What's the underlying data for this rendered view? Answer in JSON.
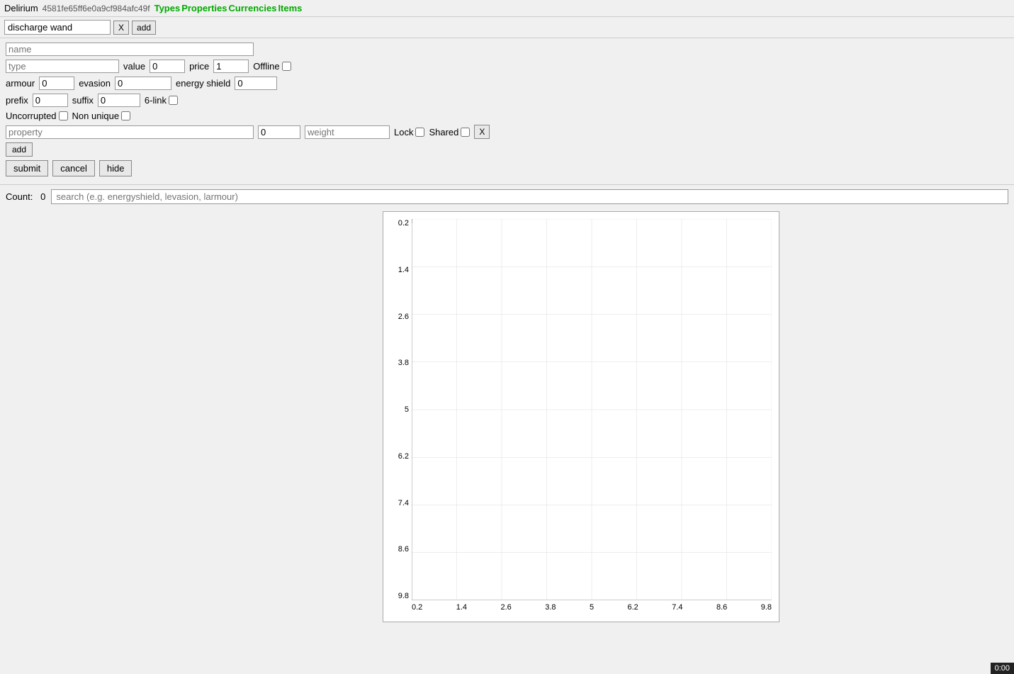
{
  "header": {
    "app_title": "Delirium",
    "app_id": "4581fe65ff6e0a9cf984afc49f",
    "nav": {
      "types_label": "Types",
      "properties_label": "Properties",
      "currencies_label": "Currencies",
      "items_label": "Items"
    }
  },
  "search_bar": {
    "input_value": "discharge wand",
    "x_button_label": "X",
    "add_button_label": "add"
  },
  "form": {
    "name_placeholder": "name",
    "type_placeholder": "type",
    "value_label": "value",
    "value_value": "0",
    "price_label": "price",
    "price_value": "1",
    "offline_label": "Offline",
    "armour_label": "armour",
    "armour_value": "0",
    "evasion_label": "evasion",
    "evasion_value": "0",
    "energy_shield_label": "energy shield",
    "energy_shield_value": "0",
    "prefix_label": "prefix",
    "prefix_value": "0",
    "suffix_label": "suffix",
    "suffix_value": "0",
    "six_link_label": "6-link",
    "uncorrupted_label": "Uncorrupted",
    "non_unique_label": "Non unique",
    "property_placeholder": "property",
    "property_num_value": "0",
    "weight_placeholder": "weight",
    "lock_label": "Lock",
    "shared_label": "Shared",
    "x_property_label": "X",
    "add_property_label": "add",
    "submit_label": "submit",
    "cancel_label": "cancel",
    "hide_label": "hide"
  },
  "count_search": {
    "count_label": "Count:",
    "count_value": "0",
    "search_placeholder": "search (e.g. energyshield, levasion, larmour)"
  },
  "chart": {
    "y_axis_labels": [
      "9.8",
      "8.6",
      "7.4",
      "6.2",
      "5",
      "3.8",
      "2.6",
      "1.4",
      "0.2"
    ],
    "x_axis_labels": [
      "0.2",
      "1.4",
      "2.6",
      "3.8",
      "5",
      "6.2",
      "7.4",
      "8.6",
      "9.8"
    ]
  },
  "time_badge": {
    "label": "0:00"
  }
}
